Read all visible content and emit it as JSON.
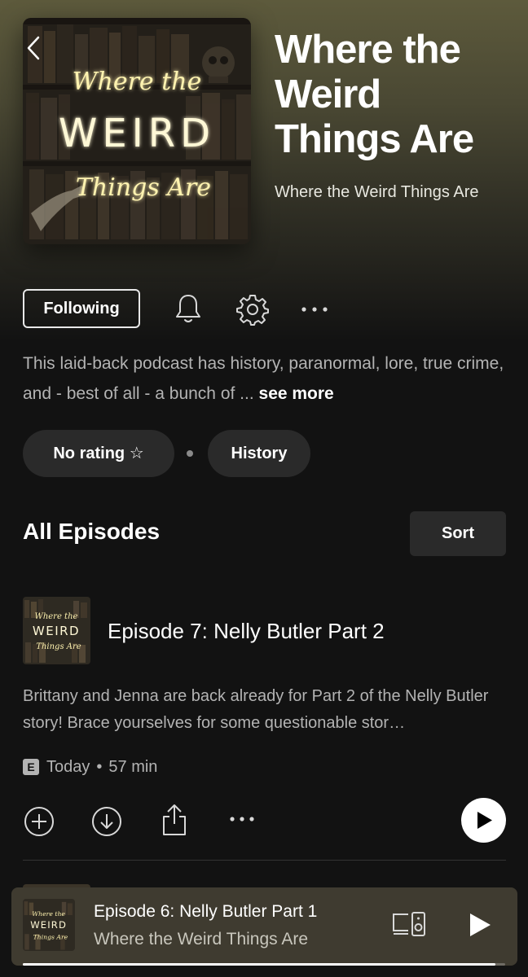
{
  "podcast": {
    "title": "Where the Weird Things Are",
    "publisher": "Where the Weird Things Are",
    "cover_art": {
      "line1": "Where the",
      "line2": "WEIRD",
      "line3": "Things Are"
    }
  },
  "actions": {
    "following_label": "Following",
    "icons": [
      "chevron-left-icon",
      "bell-icon",
      "gear-icon",
      "more-icon"
    ]
  },
  "description": {
    "text": "This laid-back podcast has history, paranormal, lore, true crime, and - best of all - a bunch of ...",
    "see_more_label": "see more"
  },
  "chips": {
    "rating_label": "No rating ☆",
    "genre_label": "History"
  },
  "episodes_section": {
    "title": "All Episodes",
    "sort_label": "Sort"
  },
  "episode": {
    "title": "Episode 7: Nelly Butler Part 2",
    "description": "Brittany and Jenna are back already for Part 2 of the Nelly Butler story! Brace yourselves for some questionable stor…",
    "explicit_badge": "E",
    "date": "Today",
    "separator": "•",
    "duration": "57 min",
    "action_icons": [
      "add-icon",
      "download-icon",
      "share-icon",
      "more-icon",
      "play-icon"
    ]
  },
  "now_playing": {
    "title": "Episode 6: Nelly Butler Part 1",
    "show": "Where the Weird Things Are",
    "progress": 0.98,
    "icons": [
      "devices-icon",
      "play-icon"
    ]
  },
  "colors": {
    "background": "#121212",
    "hero_gradient_top": "#5d5a3c",
    "chip_bg": "#2a2a2a",
    "mini_player_bg": "#3f3b30",
    "secondary_text": "#b3b3b3",
    "cover_glow": "#fff3b0"
  }
}
